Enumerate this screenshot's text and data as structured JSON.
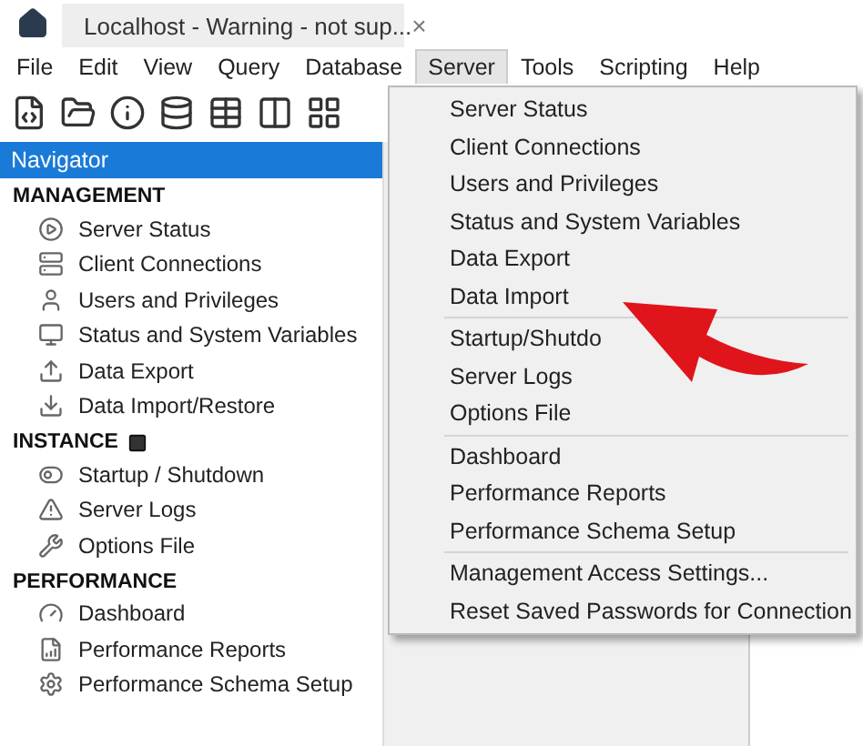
{
  "tab": {
    "title": "Localhost - Warning - not sup...",
    "close": "×"
  },
  "menubar": [
    {
      "label": "File",
      "selected": false
    },
    {
      "label": "Edit",
      "selected": false
    },
    {
      "label": "View",
      "selected": false
    },
    {
      "label": "Query",
      "selected": false
    },
    {
      "label": "Database",
      "selected": false
    },
    {
      "label": "Server",
      "selected": true
    },
    {
      "label": "Tools",
      "selected": false
    },
    {
      "label": "Scripting",
      "selected": false
    },
    {
      "label": "Help",
      "selected": false
    }
  ],
  "navigator": {
    "title": "Navigator",
    "sections": [
      {
        "title": "MANAGEMENT",
        "items": [
          "Server Status",
          "Client Connections",
          "Users and Privileges",
          "Status and System Variables",
          "Data Export",
          "Data Import/Restore"
        ]
      },
      {
        "title": "INSTANCE",
        "items": [
          "Startup / Shutdown",
          "Server Logs",
          "Options File"
        ]
      },
      {
        "title": "PERFORMANCE",
        "items": [
          "Dashboard",
          "Performance Reports",
          "Performance Schema Setup"
        ]
      }
    ]
  },
  "server_menu": [
    [
      "Server Status",
      "Client Connections",
      "Users and Privileges",
      "Status and System Variables",
      "Data Export",
      "Data Import"
    ],
    [
      "Startup/Shutdo",
      "Server Logs",
      "Options File"
    ],
    [
      "Dashboard",
      "Performance Reports",
      "Performance Schema Setup"
    ],
    [
      "Management Access Settings...",
      "Reset Saved Passwords for Connection"
    ]
  ]
}
